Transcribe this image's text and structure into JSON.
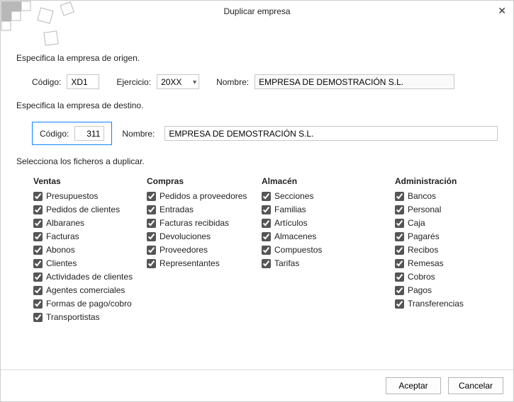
{
  "window": {
    "title": "Duplicar empresa",
    "close": "✕"
  },
  "source": {
    "heading": "Especifica la empresa de origen.",
    "codigo_label": "Código:",
    "codigo_value": "XD1",
    "ejercicio_label": "Ejercicio:",
    "ejercicio_value": "20XX",
    "nombre_label": "Nombre:",
    "nombre_value": "EMPRESA DE DEMOSTRACIÓN S.L."
  },
  "dest": {
    "heading": "Especifica la empresa de destino.",
    "codigo_label": "Código:",
    "codigo_value": "311",
    "nombre_label": "Nombre:",
    "nombre_value": "EMPRESA DE DEMOSTRACIÓN S.L."
  },
  "files": {
    "heading": "Selecciona los ficheros a duplicar.",
    "ventas": {
      "header": "Ventas",
      "items": [
        "Presupuestos",
        "Pedidos de clientes",
        "Albaranes",
        "Facturas",
        "Abonos",
        "Clientes",
        "Actividades de clientes",
        "Agentes comerciales",
        "Formas de pago/cobro",
        "Transportistas"
      ]
    },
    "compras": {
      "header": "Compras",
      "items": [
        "Pedidos a proveedores",
        "Entradas",
        "Facturas recibidas",
        "Devoluciones",
        "Proveedores",
        "Representantes"
      ]
    },
    "almacen": {
      "header": "Almacén",
      "items": [
        "Secciones",
        "Familias",
        "Artículos",
        "Almacenes",
        "Compuestos",
        "Tarifas"
      ]
    },
    "admin": {
      "header": "Administración",
      "items": [
        "Bancos",
        "Personal",
        "Caja",
        "Pagarés",
        "Recibos",
        "Remesas",
        "Cobros",
        "Pagos",
        "Transferencias"
      ]
    }
  },
  "buttons": {
    "accept": "Aceptar",
    "cancel": "Cancelar"
  }
}
